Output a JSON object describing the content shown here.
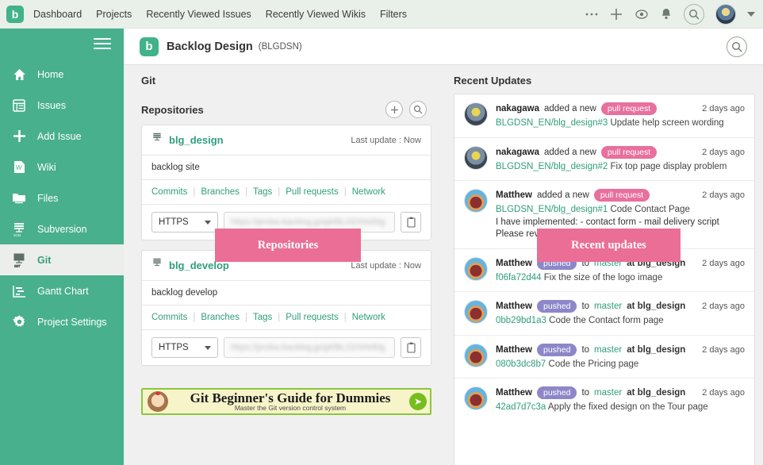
{
  "global_nav": {
    "logo": "backlog-logo-icon",
    "links": [
      {
        "label": "Dashboard"
      },
      {
        "label": "Projects"
      },
      {
        "label": "Recently Viewed Issues"
      },
      {
        "label": "Recently Viewed Wikis"
      },
      {
        "label": "Filters"
      }
    ],
    "right_icons": [
      {
        "name": "more-options-icon"
      },
      {
        "name": "add-icon"
      },
      {
        "name": "watch-eye-icon"
      },
      {
        "name": "notification-bell-icon"
      },
      {
        "name": "search-icon"
      }
    ],
    "avatar": "user-avatar",
    "avatar_caret": "chevron-down-icon"
  },
  "sidebar": {
    "toggle": "hamburger-menu-icon",
    "items": [
      {
        "label": "Home",
        "icon": "home-icon",
        "active": false
      },
      {
        "label": "Issues",
        "icon": "issues-list-icon",
        "active": false
      },
      {
        "label": "Add Issue",
        "icon": "plus-icon",
        "active": false
      },
      {
        "label": "Wiki",
        "icon": "wiki-document-icon",
        "active": false
      },
      {
        "label": "Files",
        "icon": "folder-files-icon",
        "active": false
      },
      {
        "label": "Subversion",
        "icon": "subversion-icon",
        "active": false
      },
      {
        "label": "Git",
        "icon": "git-icon",
        "active": true
      },
      {
        "label": "Gantt Chart",
        "icon": "gantt-chart-icon",
        "active": false
      },
      {
        "label": "Project Settings",
        "icon": "gear-icon",
        "active": false
      }
    ]
  },
  "project_header": {
    "logo": "project-logo-icon",
    "title": "Backlog Design",
    "key": "(BLGDSN)",
    "search_icon": "search-icon"
  },
  "git_section": {
    "heading": "Git",
    "repositories_heading": "Repositories",
    "add_button_icon": "plus-icon",
    "search_button_icon": "search-icon",
    "repositories": [
      {
        "icon": "repository-icon",
        "name": "blg_design",
        "last_update": "Last update : Now",
        "description": "backlog site",
        "links": [
          "Commits",
          "Branches",
          "Tags",
          "Pull requests",
          "Network"
        ],
        "protocol": "HTTPS",
        "clone_url": "https://proba.backlog.jp/git/BLGDSN/blg",
        "copy_icon": "clipboard-copy-icon"
      },
      {
        "icon": "repository-icon",
        "name": "blg_develop",
        "last_update": "Last update : Now",
        "description": "backlog develop",
        "links": [
          "Commits",
          "Branches",
          "Tags",
          "Pull requests",
          "Network"
        ],
        "protocol": "HTTPS",
        "clone_url": "https://proba.backlog.jp/git/BLGDSN/blg",
        "copy_icon": "clipboard-copy-icon"
      }
    ],
    "banner": {
      "title": "Git Beginner's Guide for Dummies",
      "subtitle": "Master the Git version control system",
      "mascot": "monkey-mascot-icon",
      "arrow_icon": "arrow-right-icon"
    }
  },
  "recent_updates": {
    "heading": "Recent Updates",
    "items": [
      {
        "avatar": "nakagawa-avatar",
        "avatar_class": "av-nakagawa",
        "user": "nakagawa",
        "action": "added a new",
        "badge": "pull request",
        "badge_type": "pr",
        "time": "2 days ago",
        "ref": "BLGDSN_EN/blg_design#3",
        "summary": "Update help screen wording",
        "extra1": "",
        "extra2": ""
      },
      {
        "avatar": "nakagawa-avatar",
        "avatar_class": "av-nakagawa",
        "user": "nakagawa",
        "action": "added a new",
        "badge": "pull request",
        "badge_type": "pr",
        "time": "2 days ago",
        "ref": "BLGDSN_EN/blg_design#2",
        "summary": "Fix top page display problem",
        "extra1": "",
        "extra2": ""
      },
      {
        "avatar": "matthew-avatar",
        "avatar_class": "av-matthew",
        "user": "Matthew",
        "action": "added a new",
        "badge": "pull request",
        "badge_type": "pr",
        "time": "2 days ago",
        "ref": "BLGDSN_EN/blg_design#1",
        "summary": "Code Contact Page",
        "extra1": "I have implemented: - contact form - mail delivery script",
        "extra2": "Please review and merge 👷"
      },
      {
        "avatar": "matthew-avatar",
        "avatar_class": "av-matthew",
        "user": "Matthew",
        "action_pre": "to",
        "branch": "master",
        "action_post": "at blg_design",
        "badge": "pushed",
        "badge_type": "push",
        "time": "2 days ago",
        "ref": "f06fa72d44",
        "summary": "Fix the size of the logo image",
        "extra1": "",
        "extra2": ""
      },
      {
        "avatar": "matthew-avatar",
        "avatar_class": "av-matthew",
        "user": "Matthew",
        "action_pre": "to",
        "branch": "master",
        "action_post": "at blg_design",
        "badge": "pushed",
        "badge_type": "push",
        "time": "2 days ago",
        "ref": "0bb29bd1a3",
        "summary": "Code the Contact form page",
        "extra1": "",
        "extra2": ""
      },
      {
        "avatar": "matthew-avatar",
        "avatar_class": "av-matthew",
        "user": "Matthew",
        "action_pre": "to",
        "branch": "master",
        "action_post": "at blg_design",
        "badge": "pushed",
        "badge_type": "push",
        "time": "2 days ago",
        "ref": "080b3dc8b7",
        "summary": "Code the Pricing page",
        "extra1": "",
        "extra2": ""
      },
      {
        "avatar": "matthew-avatar",
        "avatar_class": "av-matthew",
        "user": "Matthew",
        "action_pre": "to",
        "branch": "master",
        "action_post": "at blg_design",
        "badge": "pushed",
        "badge_type": "push",
        "time": "2 days ago",
        "ref": "42ad7d7c3a",
        "summary": "Apply the fixed design on the Tour page",
        "extra1": "",
        "extra2": ""
      }
    ]
  },
  "callouts": {
    "repositories": "Repositories",
    "recent_updates": "Recent updates",
    "color": "#ea6e96"
  },
  "colors": {
    "sidebar_green": "#48b08c",
    "accent_green": "#2f9e7c",
    "topbar_bg": "#e9efe9",
    "badge_pull_request": "#e86f9e",
    "badge_pushed": "#8d87c9"
  }
}
